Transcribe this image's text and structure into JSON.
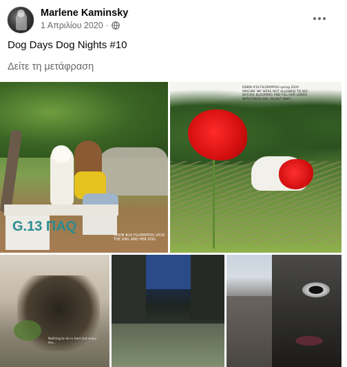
{
  "post": {
    "author": "Marlene Kaminsky",
    "date": "1 Απριλίου 2020",
    "audience_icon": "globe-icon",
    "text": "Dog Days Dog Nights #10",
    "translate_label": "Δείτε τη μετάφραση"
  },
  "photos": {
    "p1": {
      "graffiti": "G.13 ΠΑQ",
      "caption": "DDDN #10 FILOPAPPOU 2019 THE GIRL AND HER DOG"
    },
    "p2": {
      "caption": "DDDN #10 FILOPAPPOU spring 2020 IMAGINE WE WERE NOT ALLOWED TO SEE NATURE BLOOMING AND FILL OUR LUNGS WITH FRESH AIR, OH BUT WAIT..."
    },
    "p3": {
      "caption": "Nothing to do in here but enjoy the..."
    }
  },
  "colors": {
    "text_primary": "#050505",
    "text_secondary": "#65676b",
    "background": "#ffffff"
  }
}
